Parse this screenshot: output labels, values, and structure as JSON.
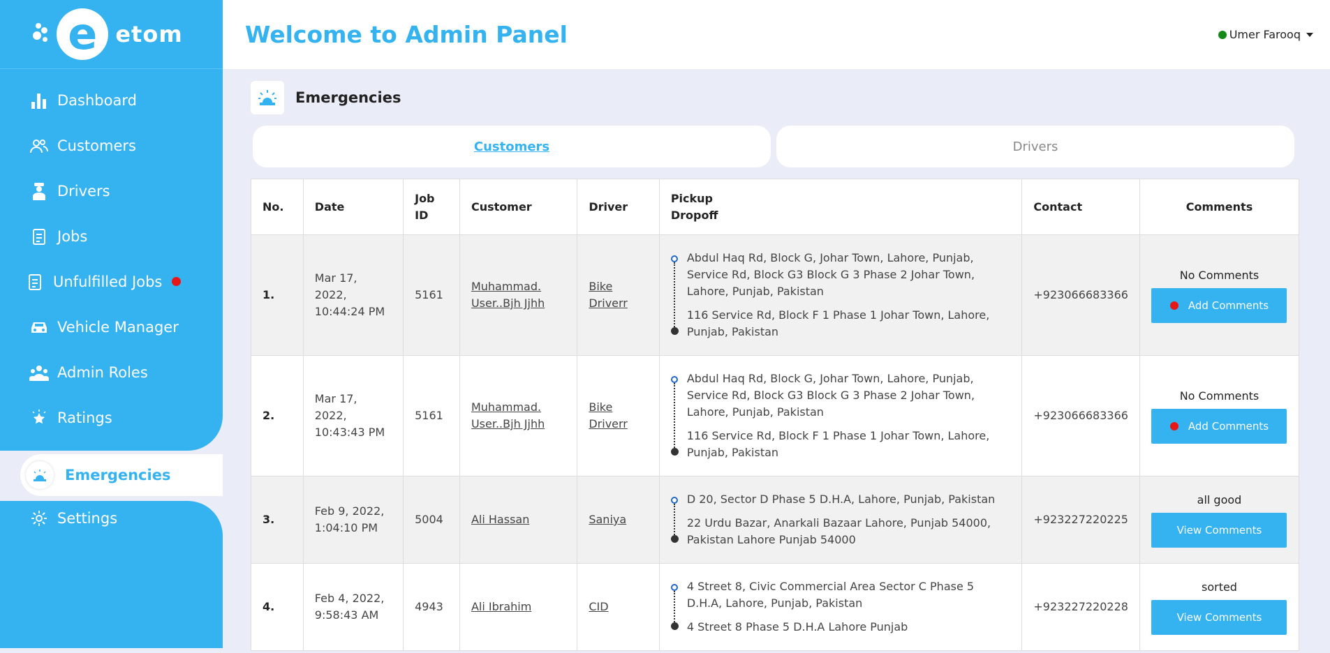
{
  "brand": {
    "name": "etom",
    "logo_letter": "e"
  },
  "header": {
    "title": "Welcome to Admin Panel",
    "user_name": "Umer Farooq"
  },
  "sidebar": {
    "items": [
      {
        "label": "Dashboard",
        "icon": "bar-chart-icon"
      },
      {
        "label": "Customers",
        "icon": "users-icon"
      },
      {
        "label": "Drivers",
        "icon": "driver-icon"
      },
      {
        "label": "Jobs",
        "icon": "clipboard-icon"
      },
      {
        "label": "Unfulfilled Jobs",
        "icon": "clipboard-icon"
      },
      {
        "label": "Vehicle Manager",
        "icon": "car-icon"
      },
      {
        "label": "Admin Roles",
        "icon": "group-icon"
      },
      {
        "label": "Ratings",
        "icon": "star-icon"
      },
      {
        "label": "Emergencies",
        "icon": "siren-icon"
      },
      {
        "label": "Settings",
        "icon": "gear-icon"
      }
    ]
  },
  "page": {
    "title": "Emergencies"
  },
  "tabs": [
    {
      "label": "Customers"
    },
    {
      "label": "Drivers"
    }
  ],
  "table": {
    "headers": {
      "no": "No.",
      "date": "Date",
      "job_id_1": "Job",
      "job_id_2": "ID",
      "customer": "Customer",
      "driver": "Driver",
      "route_1": "Pickup",
      "route_2": "Dropoff",
      "contact": "Contact",
      "comments": "Comments"
    },
    "rows": [
      {
        "no": "1.",
        "date_1": "Mar 17, 2022,",
        "date_2": "10:44:24 PM",
        "job_id": "5161",
        "customer_1": "Muhammad.",
        "customer_2": "User..Bjh Jjhh",
        "driver_1": "Bike",
        "driver_2": "Driverr",
        "pickup": "Abdul Haq Rd, Block G, Johar Town, Lahore, Punjab, Service Rd, Block G3 Block G 3 Phase 2 Johar Town, Lahore, Punjab, Pakistan",
        "dropoff": "116 Service Rd, Block F 1 Phase 1 Johar Town, Lahore, Punjab, Pakistan",
        "contact": "+923066683366",
        "comment": "No Comments",
        "button": "Add Comments"
      },
      {
        "no": "2.",
        "date_1": "Mar 17, 2022,",
        "date_2": "10:43:43 PM",
        "job_id": "5161",
        "customer_1": "Muhammad.",
        "customer_2": "User..Bjh Jjhh",
        "driver_1": "Bike",
        "driver_2": "Driverr",
        "pickup": "Abdul Haq Rd, Block G, Johar Town, Lahore, Punjab, Service Rd, Block G3 Block G 3 Phase 2 Johar Town, Lahore, Punjab, Pakistan",
        "dropoff": "116 Service Rd, Block F 1 Phase 1 Johar Town, Lahore, Punjab, Pakistan",
        "contact": "+923066683366",
        "comment": "No Comments",
        "button": "Add Comments"
      },
      {
        "no": "3.",
        "date_1": "Feb 9, 2022,",
        "date_2": "1:04:10 PM",
        "job_id": "5004",
        "customer_1": "Ali Hassan",
        "customer_2": "",
        "driver_1": "Saniya",
        "driver_2": "",
        "pickup": "D 20, Sector D Phase 5 D.H.A, Lahore, Punjab, Pakistan",
        "dropoff": "22 Urdu Bazar, Anarkali Bazaar Lahore, Punjab 54000, Pakistan Lahore Punjab 54000",
        "contact": "+923227220225",
        "comment": "all good",
        "button": "View Comments"
      },
      {
        "no": "4.",
        "date_1": "Feb 4, 2022,",
        "date_2": "9:58:43 AM",
        "job_id": "4943",
        "customer_1": "Ali Ibrahim",
        "customer_2": "",
        "driver_1": "CID",
        "driver_2": "",
        "pickup": "4 Street 8, Civic Commercial Area Sector C Phase 5 D.H.A, Lahore, Punjab, Pakistan",
        "dropoff": "4 Street 8 Phase 5 D.H.A Lahore Punjab",
        "contact": "+923227220228",
        "comment": "sorted",
        "button": "View Comments"
      }
    ]
  },
  "colors": {
    "accent": "#35b3f1",
    "alert": "#e81717",
    "online": "#138a17"
  }
}
